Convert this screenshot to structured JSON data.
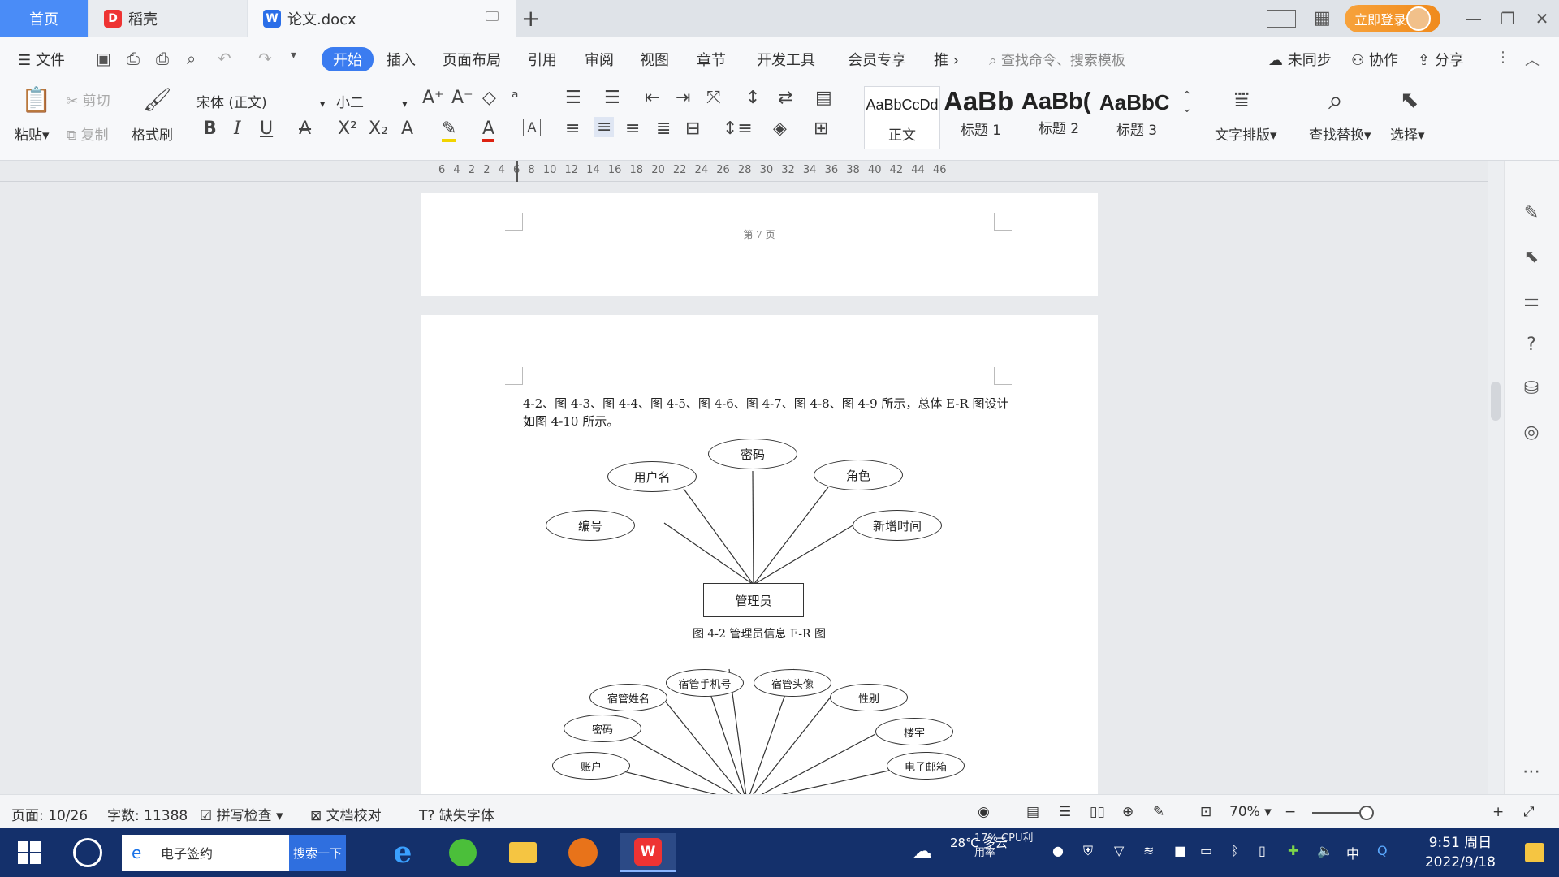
{
  "tabs": {
    "home": "首页",
    "daoke": "稻壳",
    "doc": "论文.docx",
    "login": "立即登录"
  },
  "menu": {
    "file": "文件",
    "items": [
      "开始",
      "插入",
      "页面布局",
      "引用",
      "审阅",
      "视图",
      "章节",
      "开发工具",
      "会员专享",
      "推"
    ],
    "search_placeholder": "查找命令、搜索模板",
    "unsync": "未同步",
    "collab": "协作",
    "share": "分享"
  },
  "ribbon": {
    "paste": "粘贴",
    "cut": "剪切",
    "copy": "复制",
    "format_painter": "格式刷",
    "font": "宋体 (正文)",
    "size": "小二",
    "styles": [
      {
        "preview": "AaBbCcDd",
        "label": "正文"
      },
      {
        "preview": "AaBb",
        "label": "标题 1"
      },
      {
        "preview": "AaBb(",
        "label": "标题 2"
      },
      {
        "preview": "AaBbC",
        "label": "标题 3"
      }
    ],
    "text_layout": "文字排版",
    "find_replace": "查找替换",
    "select": "选择"
  },
  "ruler": "6  4  2     2  4  6  8  10  12  14  16  18  20  22  24  26  28  30  32  34  36  38  40  42  44  46",
  "document": {
    "page_label": "第 7 页",
    "paragraph": "4-2、图 4-3、图 4-4、图 4-5、图 4-6、图 4-7、图 4-8、图 4-9 所示，总体 E-R 图设计如图 4-10 所示。",
    "diagram1": {
      "entity": "管理员",
      "attributes": [
        "编号",
        "用户名",
        "密码",
        "角色",
        "新增时间"
      ],
      "caption": "图 4-2 管理员信息 E-R 图"
    },
    "diagram2": {
      "attributes": [
        "宿管姓名",
        "宿管手机号",
        "宿管头像",
        "性别",
        "密码",
        "楼宇",
        "账户",
        "电子邮箱"
      ]
    }
  },
  "status": {
    "page": "页面: 10/26",
    "words": "字数: 11388",
    "spell": "拼写检查",
    "proof": "文档校对",
    "missing_font": "缺失字体",
    "zoom": "70%"
  },
  "taskbar": {
    "search_text": "电子签约",
    "search_btn": "搜索一下",
    "weather": "28℃ 多云",
    "cpu": "17% CPU利用率",
    "ime": "中",
    "time": "9:51 周日",
    "date": "2022/9/18"
  }
}
